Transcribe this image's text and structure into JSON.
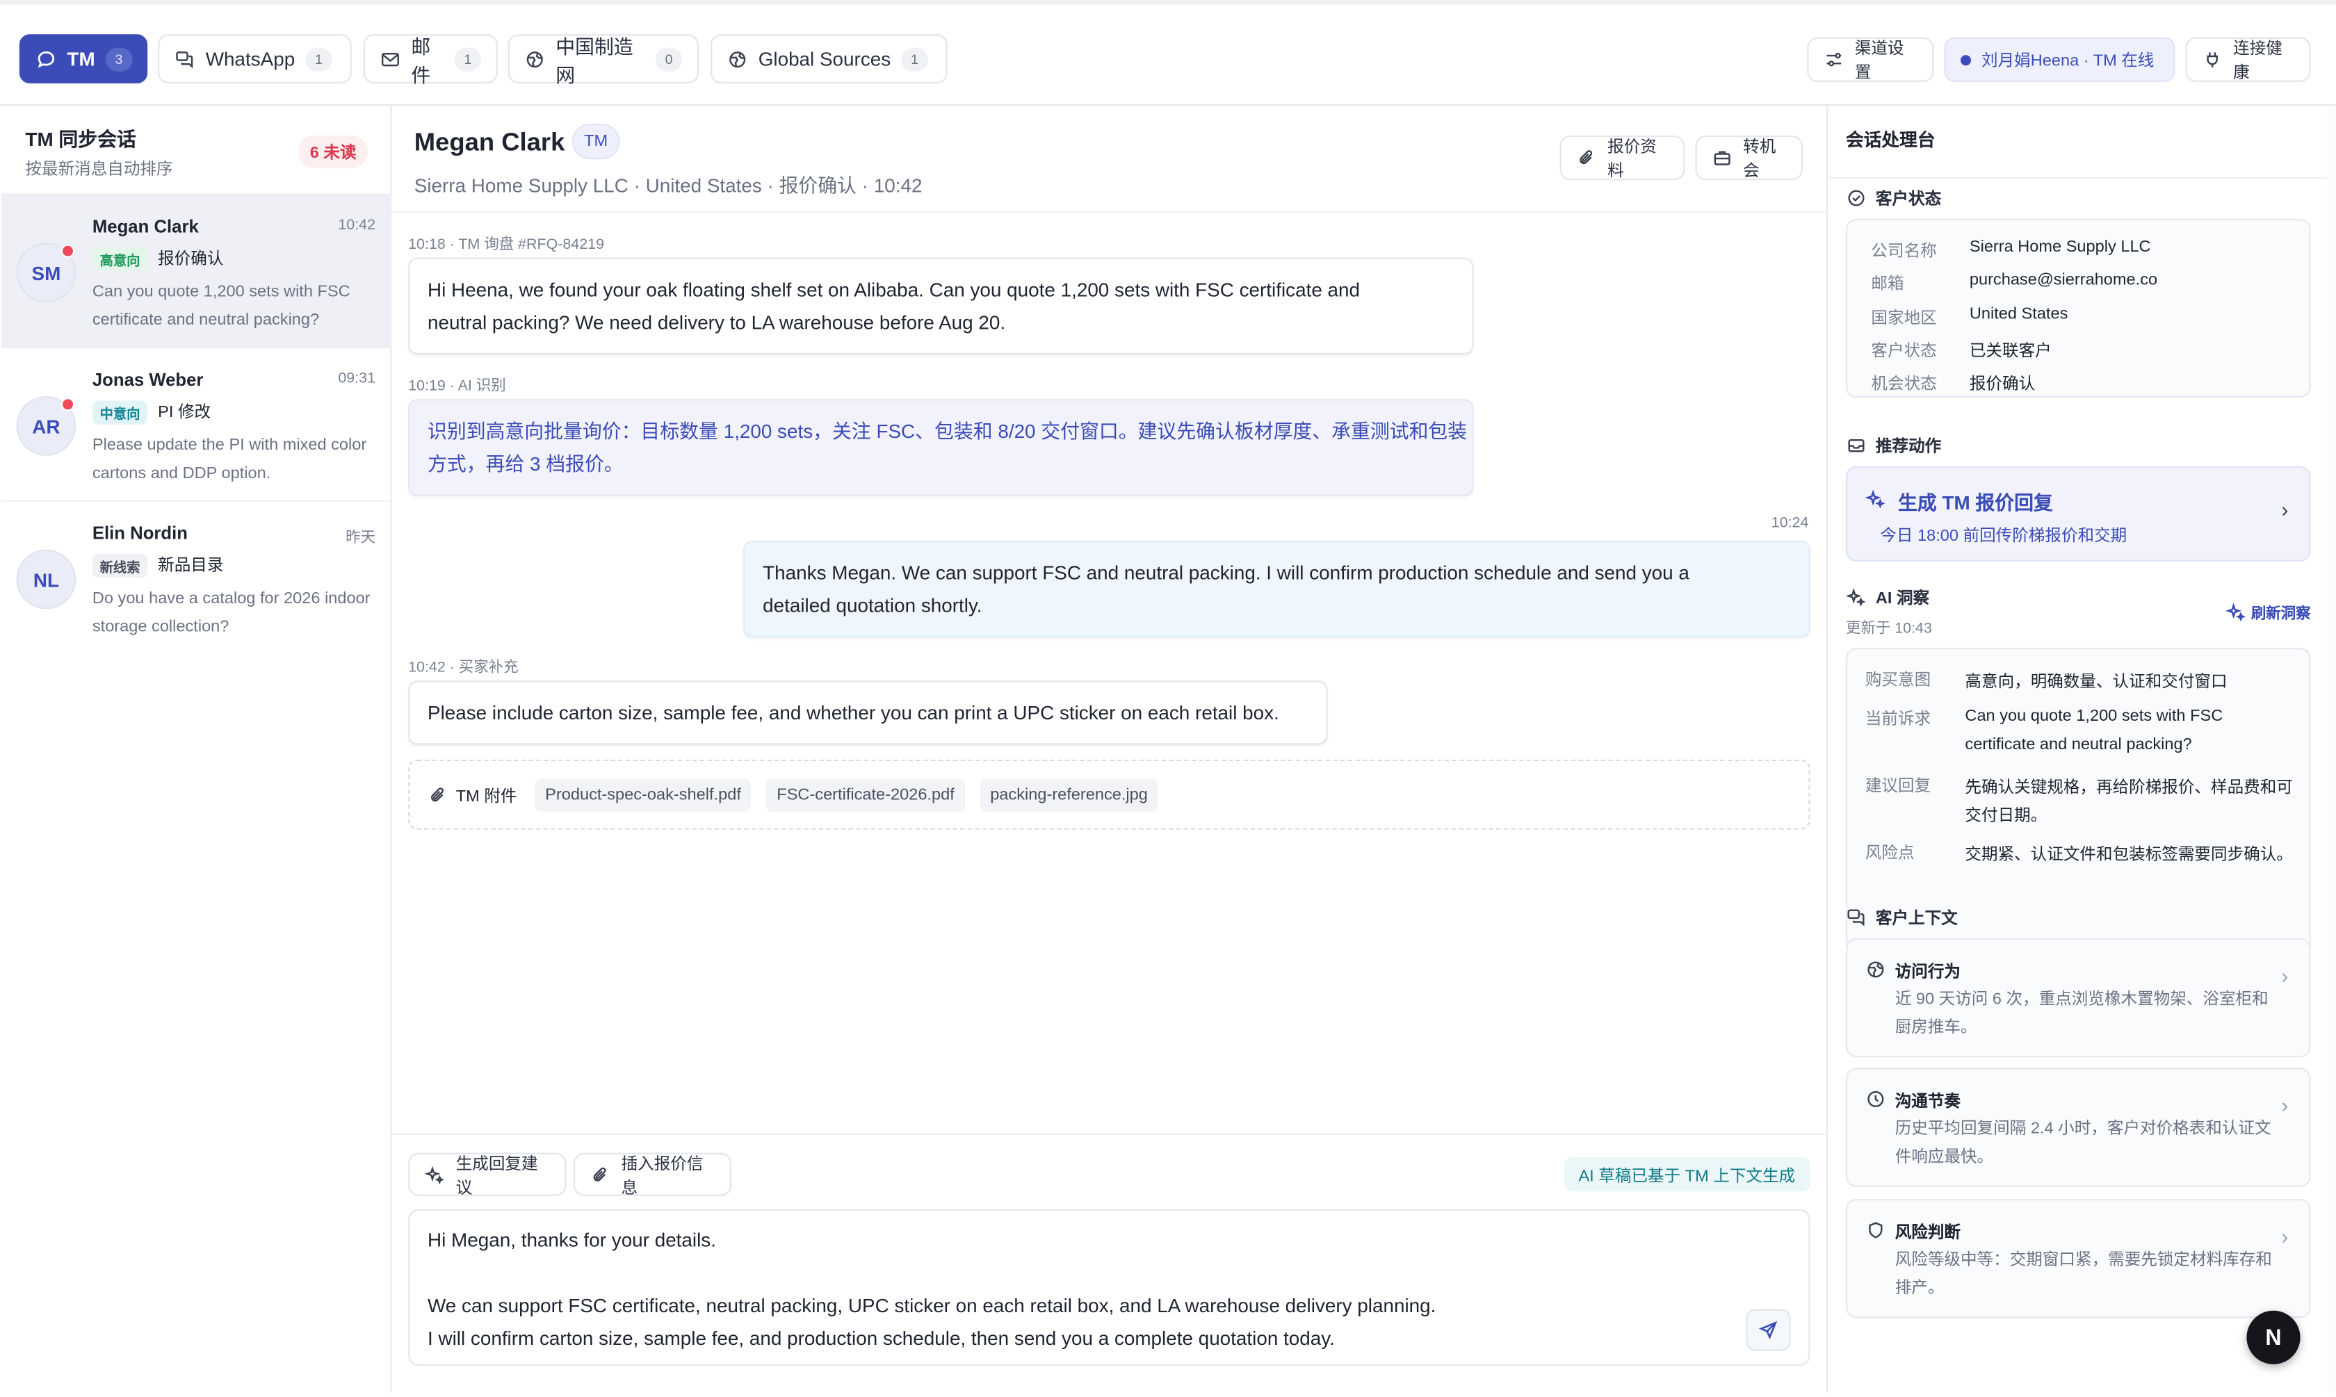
{
  "colors": {
    "accent": "#3b4cb8",
    "danger": "#d93a4f",
    "high_tag": "#1f9a5a",
    "mid_tag": "#13869a",
    "ai_badge": "#137a86"
  },
  "channels": [
    {
      "label": "TM",
      "count": "3",
      "icon": "chat-bubble-icon",
      "active": true
    },
    {
      "label": "WhatsApp",
      "count": "1",
      "icon": "chat-bubbles-icon"
    },
    {
      "label": "邮件",
      "count": "1",
      "icon": "mail-icon"
    },
    {
      "label": "中国制造网",
      "count": "0",
      "icon": "globe-icon"
    },
    {
      "label": "Global Sources",
      "count": "1",
      "icon": "globe-icon"
    }
  ],
  "toolbar": {
    "channel_settings": "渠道设置",
    "online_status": "刘月娟Heena · TM 在线",
    "connection_health": "连接健康"
  },
  "sidebar": {
    "title": "TM 同步会话",
    "subtitle": "按最新消息自动排序",
    "unread": "6 未读",
    "conversations": [
      {
        "initials": "SM",
        "name": "Megan Clark",
        "time": "10:42",
        "tag": "高意向",
        "stage": "报价确认",
        "preview": "Can you quote 1,200 sets with FSC certificate and neutral packing?"
      },
      {
        "initials": "AR",
        "name": "Jonas Weber",
        "time": "09:31",
        "tag": "中意向",
        "stage": "PI 修改",
        "preview": "Please update the PI with mixed color cartons and DDP option."
      },
      {
        "initials": "NL",
        "name": "Elin Nordin",
        "time": "昨天",
        "tag": "新线索",
        "stage": "新品目录",
        "preview": "Do you have a catalog for 2026 indoor storage collection?"
      }
    ]
  },
  "chat": {
    "name": "Megan Clark",
    "channel_badge": "TM",
    "subtitle": "Sierra Home Supply LLC · United States · 报价确认 · 10:42",
    "quote_material": "报价资料",
    "to_opportunity": "转机会",
    "messages": [
      {
        "meta": "10:18 · TM 询盘 #RFQ-84219",
        "lines": [
          "Hi Heena, we found your oak floating shelf set on Alibaba. Can you quote 1,200 sets with FSC certificate and",
          "neutral packing? We need delivery to LA warehouse before Aug 20."
        ]
      },
      {
        "meta": "10:19 · AI 识别",
        "lines": [
          "识别到高意向批量询价：目标数量 1,200 sets，关注 FSC、包装和 8/20 交付窗口。建议先确认板材厚度、承重测试和包装",
          "方式，再给 3 档报价。"
        ]
      },
      {
        "meta": "10:24",
        "lines": [
          "Thanks Megan. We can support FSC and neutral packing. I will confirm production schedule and send you a",
          "detailed quotation shortly."
        ]
      },
      {
        "meta": "10:42 · 买家补充",
        "lines": [
          "Please include carton size, sample fee, and whether you can print a UPC sticker on each retail box."
        ]
      }
    ],
    "attachments_label": "TM 附件",
    "attachments": [
      "Product-spec-oak-shelf.pdf",
      "FSC-certificate-2026.pdf",
      "packing-reference.jpg"
    ]
  },
  "composer": {
    "generate_reply": "生成回复建议",
    "insert_quote": "插入报价信息",
    "ai_badge": "AI 草稿已基于 TM 上下文生成",
    "draft_lines": [
      "Hi Megan, thanks for your details.",
      "",
      "We can support FSC certificate, neutral packing, UPC sticker on each retail box, and LA warehouse delivery planning.",
      "I will confirm carton size, sample fee, and production schedule, then send you a complete quotation today."
    ]
  },
  "panel": {
    "title": "会话处理台",
    "customer_status_title": "客户状态",
    "customer_fields": [
      {
        "label": "公司名称",
        "value": "Sierra Home Supply LLC"
      },
      {
        "label": "邮箱",
        "value": "purchase@sierrahome.co"
      },
      {
        "label": "国家地区",
        "value": "United States"
      },
      {
        "label": "客户状态",
        "value": "已关联客户"
      },
      {
        "label": "机会状态",
        "value": "报价确认"
      }
    ],
    "recommended_title": "推荐动作",
    "recommended_action": "生成 TM 报价回复",
    "recommended_sub": "今日 18:00 前回传阶梯报价和交期",
    "insight_title": "AI 洞察",
    "insight_updated": "更新于 10:43",
    "refresh_insight": "刷新洞察",
    "insights": [
      {
        "label": "购买意图",
        "lines": [
          "高意向，明确数量、认证和交付窗口"
        ]
      },
      {
        "label": "当前诉求",
        "lines": [
          "Can you quote 1,200 sets with FSC",
          "certificate and neutral packing?"
        ]
      },
      {
        "label": "建议回复",
        "lines": [
          "先确认关键规格，再给阶梯报价、样品费和可",
          "交付日期。"
        ]
      },
      {
        "label": "风险点",
        "lines": [
          "交期紧、认证文件和包装标签需要同步确认。"
        ]
      }
    ],
    "context_title": "客户上下文",
    "contexts": [
      {
        "title": "访问行为",
        "icon": "globe-icon",
        "desc": "近 90 天访问 6 次，重点浏览橡木置物架、浴室柜和厨房推车。"
      },
      {
        "title": "沟通节奏",
        "icon": "clock-icon",
        "desc": "历史平均回复间隔 2.4 小时，客户对价格表和认证文件响应最快。"
      },
      {
        "title": "风险判断",
        "icon": "shield-icon",
        "desc": "风险等级中等：交期窗口紧，需要先锁定材料库存和排产。"
      }
    ]
  },
  "fab": "N"
}
